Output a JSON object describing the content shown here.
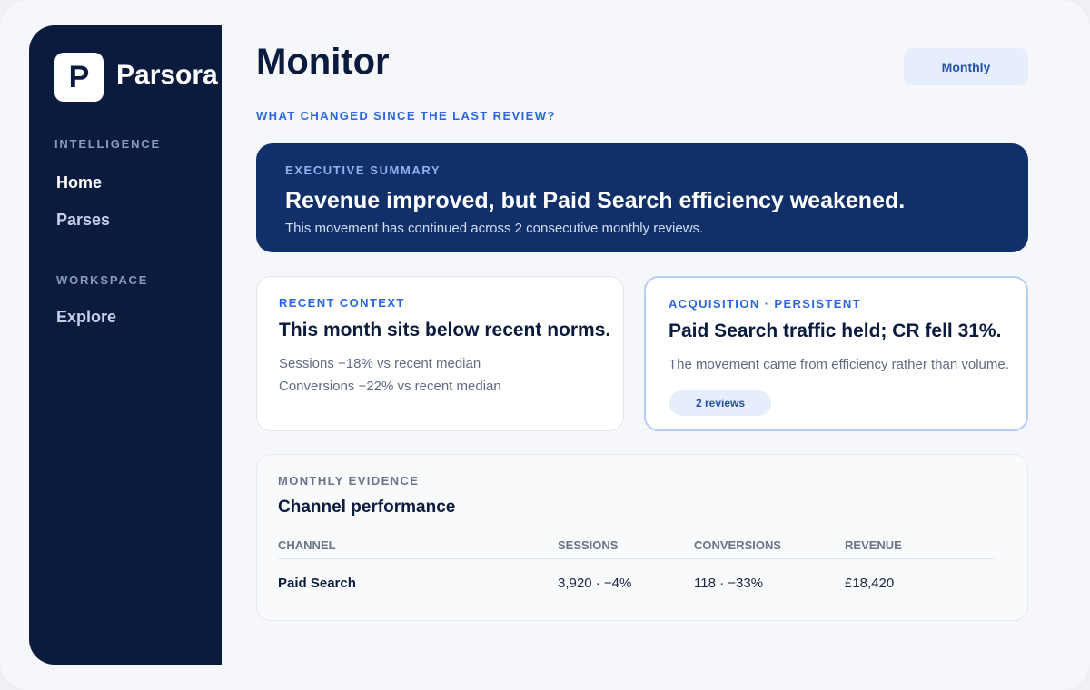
{
  "brand": {
    "logo_letter": "P",
    "name": "Parsora"
  },
  "sidebar": {
    "sections": [
      {
        "label": "INTELLIGENCE",
        "items": [
          {
            "label": "Home",
            "active": true
          },
          {
            "label": "Parses",
            "active": false
          }
        ]
      },
      {
        "label": "WORKSPACE",
        "items": [
          {
            "label": "Explore",
            "active": false
          }
        ]
      }
    ]
  },
  "header": {
    "title": "Monitor",
    "period_label": "Monthly"
  },
  "question": "WHAT CHANGED SINCE THE LAST REVIEW?",
  "executive_summary": {
    "eyebrow": "EXECUTIVE SUMMARY",
    "headline": "Revenue improved, but Paid Search efficiency weakened.",
    "sub": "This movement has continued across 2 consecutive monthly reviews."
  },
  "recent_context": {
    "eyebrow": "RECENT CONTEXT",
    "title": "This month sits below recent norms.",
    "lines": [
      "Sessions −18% vs recent median",
      "Conversions −22% vs recent median"
    ]
  },
  "acquisition": {
    "eyebrow": "ACQUISITION · PERSISTENT",
    "title": "Paid Search traffic held; CR fell 31%.",
    "body": "The movement came from efficiency rather than volume.",
    "badge": "2 reviews"
  },
  "evidence": {
    "eyebrow": "MONTHLY EVIDENCE",
    "title": "Channel performance",
    "columns": [
      "CHANNEL",
      "SESSIONS",
      "CONVERSIONS",
      "REVENUE"
    ],
    "rows": [
      [
        "Paid Search",
        "3,920 · −4%",
        "118 · −33%",
        "£18,420"
      ]
    ]
  },
  "colors": {
    "sidebar_bg": "#0b1b3e",
    "summary_bg": "#11306a",
    "accent": "#2a66e0",
    "page_bg": "#f6f7fb"
  }
}
